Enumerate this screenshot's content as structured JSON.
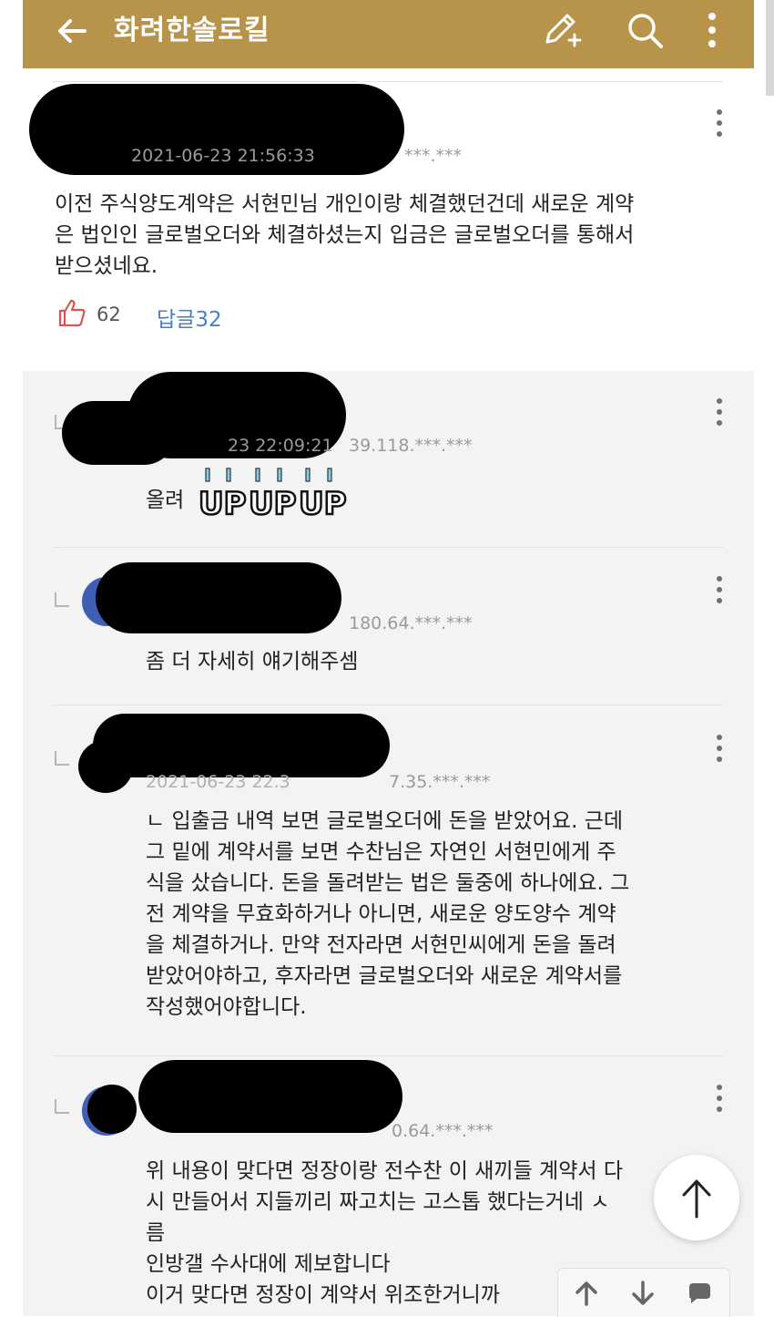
{
  "app": {
    "title": "화려한솔로킬"
  },
  "icons": {
    "back": "arrow-left-icon",
    "write": "pencil-plus-icon",
    "search": "search-icon",
    "more": "more-vertical-icon",
    "like": "thumbs-up-icon",
    "fab": "arrow-up-icon",
    "toolbar": [
      "arrow-up-icon",
      "arrow-down-icon",
      "chat-bubble-icon"
    ]
  },
  "colors": {
    "appbar": "#b8934a",
    "link": "#4a7fc0",
    "like": "#d9534f"
  },
  "post": {
    "timestamp": "2021-06-23 21:56:33",
    "ip": "***.***",
    "lines": [
      "이전 주식양도계약은 서현민님 개인이랑 체결했던건데 새로운 계약",
      "은 법인인 글로벌오더와 체결하셨는지 입금은 글로벌오더를 통해서",
      "받으셨네요."
    ],
    "likes": "62",
    "reply_label": "답글32"
  },
  "replies": [
    {
      "meta": "23 22:09:21",
      "ip": "39.118.***.***",
      "prefix": "올려",
      "lines": []
    },
    {
      "meta": "",
      "ip": "180.64.***.***",
      "lines": [
        "좀 더 자세히 얘기해주셈"
      ]
    },
    {
      "meta": "2021-06-23 22.3",
      "ip": "7.35.***.***",
      "lines": [
        "ㄴ 입출금 내역 보면 글로벌오더에 돈을 받았어요. 근데",
        "그 밑에 계약서를 보면 수찬님은 자연인 서현민에게 주",
        "식을 샀습니다. 돈을 돌려받는 법은 둘중에 하나에요. 그",
        "전 계약을 무효화하거나 아니면, 새로운 양도양수 계약",
        "을 체결하거나. 만약 전자라면 서현민씨에게 돈을 돌려",
        "받았어야하고, 후자라면 글로벌오더와 새로운 계약서를",
        "작성했어야합니다."
      ]
    },
    {
      "meta": "",
      "ip": "0.64.***.***",
      "lines": [
        "위 내용이 맞다면 정장이랑 전수찬 이 새끼들 계약서 다",
        "시 만들어서 지들끼리 짜고치는 고스톱 했다는거네 ㅅ",
        "름",
        "인방갤 수사대에 제보합니다",
        "이거 맞다면 정장이 계약서 위조한거니까"
      ]
    }
  ]
}
